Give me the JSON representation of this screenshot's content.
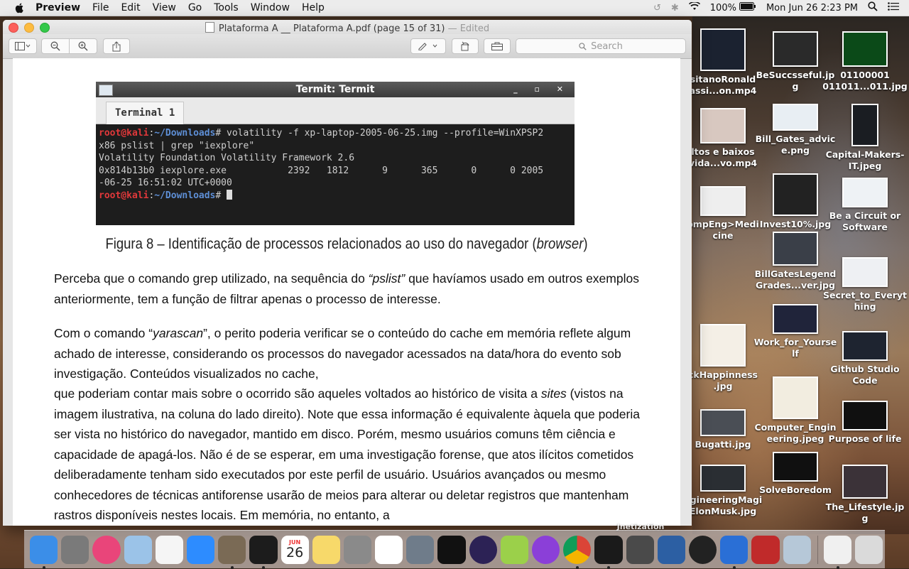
{
  "menubar": {
    "app": "Preview",
    "items": [
      "File",
      "Edit",
      "View",
      "Go",
      "Tools",
      "Window",
      "Help"
    ],
    "battery": "100%",
    "clock": "Mon Jun 26  2:23 PM"
  },
  "window": {
    "title": "Plataforma A __ Plataforma A.pdf (page 15 of 31)",
    "edited": "— Edited",
    "search_placeholder": "Search"
  },
  "document": {
    "terminal": {
      "title": "Termit: Termit",
      "tab": "Terminal 1",
      "prompt_user": "root@kali",
      "prompt_sep": ":",
      "prompt_path": "~/Downloads",
      "prompt_end": "#",
      "command_1": " volatility -f xp-laptop-2005-06-25.img --profile=WinXPSP2",
      "command_2": "x86 pslist | grep \"iexplore\"",
      "out_1": "Volatility Foundation Volatility Framework 2.6",
      "out_2": "0x814b13b0 iexplore.exe           2392   1812      9      365      0      0 2005",
      "out_3": "-06-25 16:51:02 UTC+0000"
    },
    "caption": "Figura 8 – Identificação de processos relacionados ao uso do navegador (",
    "caption_italic": "browser",
    "caption_end": ")",
    "para1": [
      "Perceba que o comando grep utilizado, na sequência do ",
      "“pslist”",
      " que havíamos usado em outros exemplos anteriormente, tem a função de filtrar apenas o processo de interesse."
    ],
    "para2_a": "Com o comando “",
    "para2_b": "yarascan",
    "para2_c": "”, o perito poderia verificar se o conteúdo do cache em memória reflete algum achado de interesse, considerando os processos do navegador acessados na data/hora do evento sob investigação. Conteúdos visualizados no cache,",
    "para3_a": "que poderiam contar mais sobre o ocorrido são aqueles voltados ao histórico de visita a ",
    "para3_b": "sites",
    "para3_c": " (vistos na imagem ilustrativa, na coluna do lado direito). Note que essa informação é equivalente àquela que poderia ser vista no histórico do navegador, mantido em disco. Porém, mesmo usuários comuns têm ciência e capacidade de apagá-los. Não é de se esperar, em uma investigação forense, que atos ilícitos cometidos deliberadamente tenham sido executados por este perfil de usuário. Usuários avançados ou mesmo conhecedores de técnicas antiforense usarão de meios para alterar ou deletar registros que mantenham rastros disponíveis nestes locais. Em memória, no entanto, a"
  },
  "desktop": [
    {
      "label": "sitanoRonald assi...on.mp4",
      "thumb": "#1b2230"
    },
    {
      "label": "BeSuccsseful.jp g",
      "thumb": "#2a2a2a"
    },
    {
      "label": "01100001 011011...011.jpg",
      "thumb": "#0b4a18"
    },
    {
      "label": "ltos e baixos vida...vo.mp4",
      "thumb": "#d8c8c0"
    },
    {
      "label": "Bill_Gates_advic e.png",
      "thumb": "#e8eef3"
    },
    {
      "label": "Capital-Makers-IT.jpeg",
      "thumb": "#1a1d22"
    },
    {
      "label": "ompEng>Medi cine",
      "thumb": "#eeeeee"
    },
    {
      "label": "Invest10%.jpg",
      "thumb": "#222222"
    },
    {
      "label": "Be a Circuit or Software",
      "thumb": "#eef2f5"
    },
    {
      "label": "BillGatesLegend Grades...ver.jpg",
      "thumb": "#3a3f48"
    },
    {
      "label": "Secret_to_Everyt hing",
      "thumb": "#eef0f3"
    },
    {
      "label": "Work_for_Yourse lf",
      "thumb": "#20243a"
    },
    {
      "label": "Github Studio Code",
      "thumb": "#1e2430"
    },
    {
      "label": "ckHappinness .jpg",
      "thumb": "#f4efe6"
    },
    {
      "label": "Computer_Engin eering.jpeg",
      "thumb": "#f2ede0"
    },
    {
      "label": "Bugatti.jpg",
      "thumb": "#4a4e55"
    },
    {
      "label": "Purpose of life",
      "thumb": "#101010"
    },
    {
      "label": "SolveBoredom",
      "thumb": "#101010"
    },
    {
      "label": "ngineeringMagi ElonMusk.jpg",
      "thumb": "#2a2e33"
    },
    {
      "label": "The_Lifestyle.jp g",
      "thumb": "#3b3238"
    }
  ],
  "dock": [
    {
      "name": "Finder",
      "color": "#3b8ee8"
    },
    {
      "name": "System Preferences",
      "color": "#7a7a7a"
    },
    {
      "name": "iTunes",
      "color": "#e9457a"
    },
    {
      "name": "Preview",
      "color": "#9bc3e8"
    },
    {
      "name": "Photos",
      "color": "#f5f5f5"
    },
    {
      "name": "Zoom",
      "color": "#2d8cff"
    },
    {
      "name": "Wireshark",
      "color": "#7a6a55"
    },
    {
      "name": "Activity Monitor",
      "color": "#1c1c1c"
    },
    {
      "name": "Calendar",
      "color": "#ffffff"
    },
    {
      "name": "Notes",
      "color": "#f7d96a"
    },
    {
      "name": "Calculator",
      "color": "#8a8a8a"
    },
    {
      "name": "Reminders",
      "color": "#ffffff"
    },
    {
      "name": "Launchpad",
      "color": "#6f7c8a"
    },
    {
      "name": "IntelliJ",
      "color": "#111111"
    },
    {
      "name": "Eclipse",
      "color": "#2c2255"
    },
    {
      "name": "Android Studio",
      "color": "#9bd04a"
    },
    {
      "name": "Podcast",
      "color": "#8b3fd8"
    },
    {
      "name": "Chrome",
      "color": "#ffffff"
    },
    {
      "name": "Terminal",
      "color": "#1a1a1a"
    },
    {
      "name": "Sublime Text",
      "color": "#4a4a4a"
    },
    {
      "name": "VirtualBox",
      "color": "#2c5fa3"
    },
    {
      "name": "Record",
      "color": "#222222"
    },
    {
      "name": "Network",
      "color": "#2a6fd6"
    },
    {
      "name": "Image Capture",
      "color": "#c02a2a"
    },
    {
      "name": "Preview 2",
      "color": "#b6c8d8"
    },
    {
      "name": "Document",
      "color": "#f0f0f0"
    },
    {
      "name": "Trash",
      "color": "#dadada"
    }
  ],
  "dock_calendar": {
    "month": "JUN",
    "day": "26"
  },
  "dock_overflow_label": "Jnetization"
}
